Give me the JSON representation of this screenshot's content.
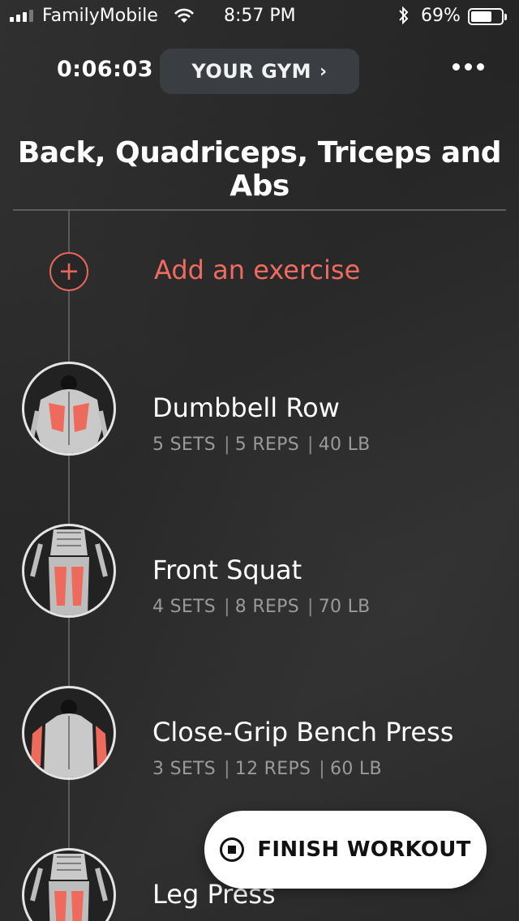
{
  "status_bar": {
    "carrier": "FamilyMobile",
    "time": "8:57 PM",
    "battery": "69%",
    "battery_level": 0.69
  },
  "header": {
    "timer": "0:06:03",
    "gym_label": "YOUR GYM",
    "gym_chevron": "›",
    "more_icon": "more-dots-icon"
  },
  "workout": {
    "title": "Back, Quadriceps, Triceps and Abs"
  },
  "add_exercise": {
    "icon": "plus-circle-icon",
    "label": "Add an exercise",
    "accent_color": "#ef6b5f"
  },
  "exercises": [
    {
      "name": "Dumbbell Row",
      "sets": "5 SETS",
      "reps": "5 REPS",
      "weight": "40 LB",
      "icon": "back-muscle-icon"
    },
    {
      "name": "Front Squat",
      "sets": "4 SETS",
      "reps": "8 REPS",
      "weight": "70 LB",
      "icon": "quadriceps-muscle-icon"
    },
    {
      "name": "Close-Grip Bench Press",
      "sets": "3 SETS",
      "reps": "12 REPS",
      "weight": "60 LB",
      "icon": "triceps-muscle-icon"
    },
    {
      "name": "Leg Press",
      "sets": "",
      "reps": "",
      "weight": "",
      "icon": "quadriceps-muscle-icon"
    }
  ],
  "finish": {
    "label": "FINISH WORKOUT",
    "icon": "stop-circle-icon"
  },
  "separator": "|"
}
